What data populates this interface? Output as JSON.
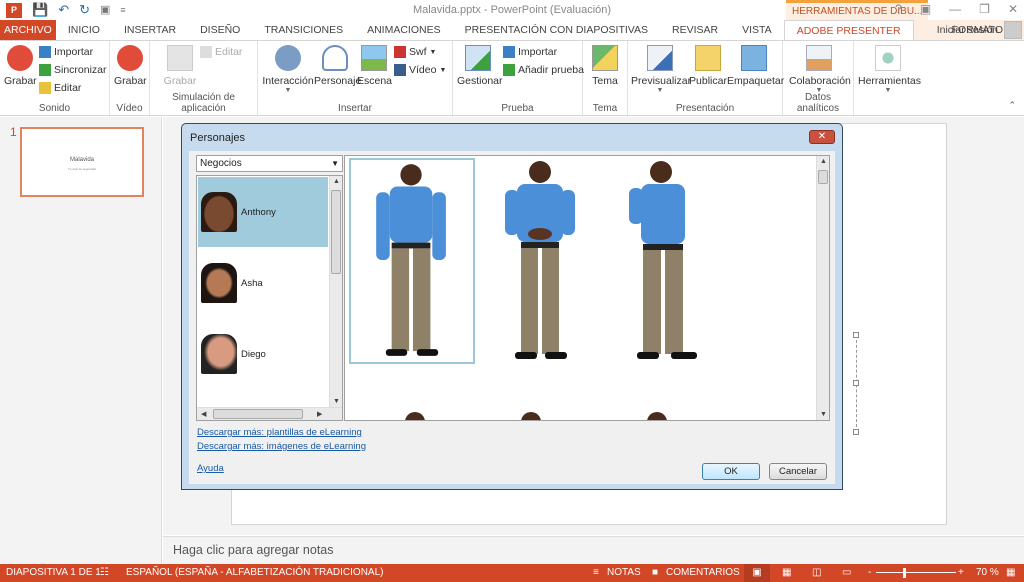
{
  "window": {
    "title": "Malavida.pptx - PowerPoint (Evaluación)",
    "contextual_group": "HERRAMIENTAS DE DIBU...",
    "controls": [
      "?",
      "ribbon-display",
      "minimize",
      "restore",
      "close"
    ],
    "signin": "Iniciar sesión"
  },
  "qat": {
    "icons": [
      "powerpoint-logo",
      "save-icon",
      "undo-icon",
      "redo-icon",
      "presentation-icon"
    ]
  },
  "tabs": [
    {
      "label": "ARCHIVO"
    },
    {
      "label": "INICIO"
    },
    {
      "label": "INSERTAR"
    },
    {
      "label": "DISEÑO"
    },
    {
      "label": "TRANSICIONES"
    },
    {
      "label": "ANIMACIONES"
    },
    {
      "label": "PRESENTACIÓN CON DIAPOSITIVAS"
    },
    {
      "label": "REVISAR"
    },
    {
      "label": "VISTA"
    },
    {
      "label": "ADOBE PRESENTER"
    },
    {
      "label": "FORMATO"
    }
  ],
  "active_tab": "ADOBE PRESENTER",
  "ribbon": {
    "sonido": {
      "label": "Sonido",
      "grabar": "Grabar",
      "importar": "Importar",
      "sincronizar": "Sincronizar",
      "editar": "Editar"
    },
    "video": {
      "label": "Vídeo",
      "grabar": "Grabar"
    },
    "simulacion": {
      "label": "Simulación de aplicación",
      "grabar": "Grabar",
      "editar": "Editar"
    },
    "insertar": {
      "label": "Insertar",
      "interaccion": "Interacción",
      "personaje": "Personaje",
      "escena": "Escena",
      "swf": "Swf",
      "video": "Vídeo"
    },
    "prueba": {
      "label": "Prueba",
      "gestionar": "Gestionar",
      "importar": "Importar",
      "anadir": "Añadir prueba"
    },
    "tema": {
      "label": "Tema",
      "tema": "Tema"
    },
    "presentacion": {
      "label": "Presentación",
      "previsualizar": "Previsualizar",
      "publicar": "Publicar",
      "empaquetar": "Empaquetar"
    },
    "datos": {
      "label": "Datos analíticos",
      "colaboracion": "Colaboración"
    },
    "herramientas": {
      "label": "Herramientas"
    }
  },
  "slides_pane": {
    "slide_number": "1",
    "thumb_title": "Malavida",
    "thumb_subtitle": "Tu web de seguridad"
  },
  "notes_placeholder": "Haga clic para agregar notas",
  "status": {
    "slide": "DIAPOSITIVA 1 DE 1",
    "language": "ESPAÑOL (ESPAÑA - ALFABETIZACIÓN TRADICIONAL)",
    "notas": "NOTAS",
    "comentarios": "COMENTARIOS",
    "zoom_minus": "-",
    "zoom_plus": "+",
    "zoom": "70 %",
    "zoom_value_percent": 70
  },
  "dialog": {
    "title": "Personajes",
    "category": "Negocios",
    "characters": [
      {
        "name": "Anthony",
        "selected": true
      },
      {
        "name": "Asha",
        "selected": false
      },
      {
        "name": "Diego",
        "selected": false
      }
    ],
    "poses_selected_index": 0,
    "link_templates": "Descargar más: plantillas de eLearning",
    "link_images": "Descargar más: imágenes de eLearning",
    "help": "Ayuda",
    "ok": "OK",
    "cancel": "Cancelar"
  }
}
